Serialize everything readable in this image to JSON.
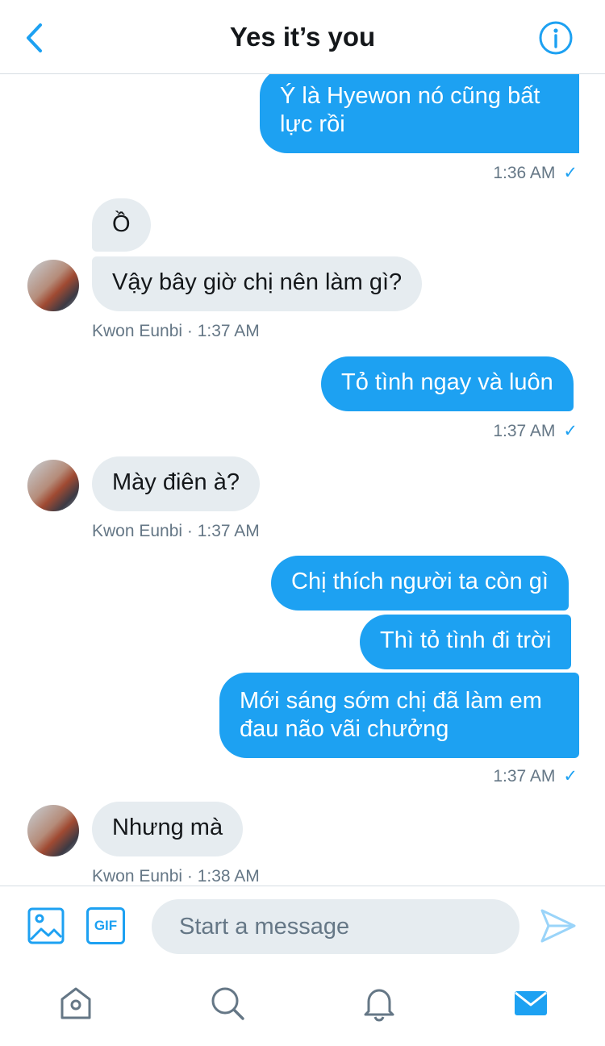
{
  "header": {
    "title": "Yes it’s you",
    "back_icon": "chevron-left-icon",
    "info_icon": "info-icon"
  },
  "colors": {
    "accent": "#1da1f2",
    "incoming_bubble": "#e6ecf0",
    "meta_text": "#657786"
  },
  "messages": [
    {
      "dir": "out",
      "text": "Ý là Hyewon nó cũng bất lực rồi"
    },
    {
      "dir": "out_meta",
      "time": "1:36 AM"
    },
    {
      "dir": "in",
      "text": "Ồ"
    },
    {
      "dir": "in",
      "text": "Vậy bây giờ chị nên làm gì?"
    },
    {
      "dir": "in_meta",
      "sender": "Kwon Eunbi",
      "time": "1:37 AM"
    },
    {
      "dir": "out",
      "text": "Tỏ tình ngay và luôn"
    },
    {
      "dir": "out_meta",
      "time": "1:37 AM"
    },
    {
      "dir": "in",
      "text": "Mày điên à?"
    },
    {
      "dir": "in_meta",
      "sender": "Kwon Eunbi",
      "time": "1:37 AM"
    },
    {
      "dir": "out",
      "text": "Chị thích người ta còn gì"
    },
    {
      "dir": "out",
      "text": "Thì tỏ tình đi trời"
    },
    {
      "dir": "out",
      "text": "Mới sáng sớm chị đã làm em đau não vãi chưởng"
    },
    {
      "dir": "out_meta",
      "time": "1:37 AM"
    },
    {
      "dir": "in",
      "text": "Nhưng mà"
    },
    {
      "dir": "in_meta",
      "sender": "Kwon Eunbi",
      "time": "1:38 AM"
    }
  ],
  "meta_strings": {
    "m1": "1:36 AM",
    "m2": "Kwon Eunbi · 1:37 AM",
    "m3": "1:37 AM",
    "m4": "Kwon Eunbi · 1:37 AM",
    "m5": "1:37 AM",
    "m6": "Kwon Eunbi · 1:38 AM",
    "check": "✓"
  },
  "composer": {
    "placeholder": "Start a message",
    "gif_label": "GIF",
    "media_icon": "image-icon",
    "send_icon": "send-icon"
  },
  "tabbar": {
    "items": [
      "home-icon",
      "search-icon",
      "notifications-icon",
      "messages-icon"
    ],
    "active": "messages-icon"
  }
}
